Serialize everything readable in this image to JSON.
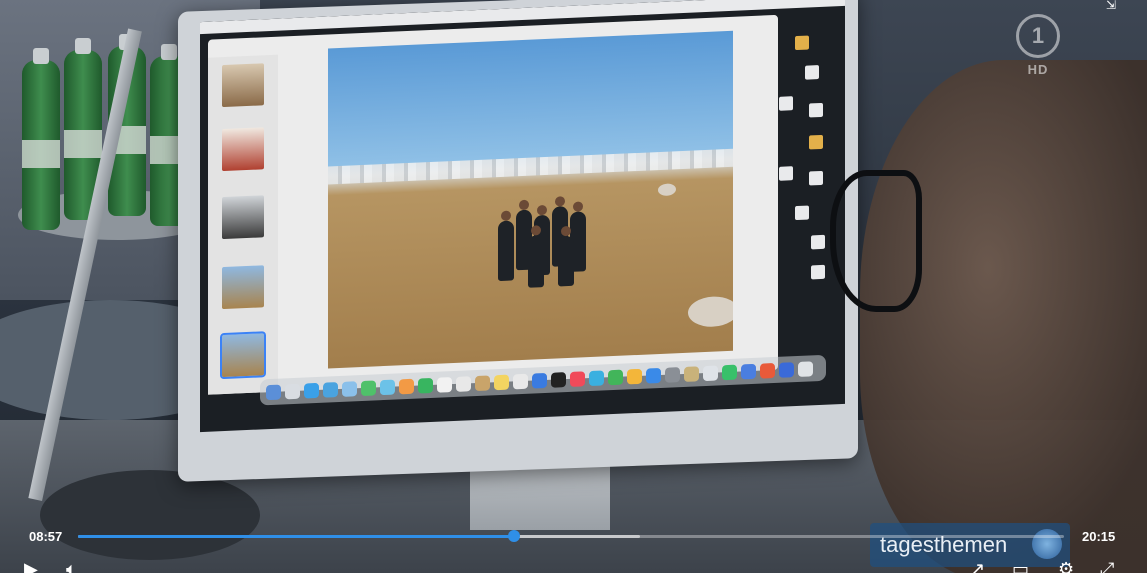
{
  "player": {
    "current_time": "08:57",
    "total_time": "20:15",
    "progress_fraction": 0.442,
    "buffered_fraction": 0.57,
    "progress_color": "#2f8fe8"
  },
  "overlay": {
    "channel_logo": "1",
    "channel_quality": "HD",
    "brand_name": "tagesthemen"
  },
  "icons": {
    "pip": "picture-in-picture-off-icon",
    "play": "play-icon",
    "volume": "volume-icon",
    "share": "share-icon",
    "subtitles": "subtitles-icon",
    "settings": "settings-icon",
    "fullscreen": "fullscreen-icon"
  }
}
